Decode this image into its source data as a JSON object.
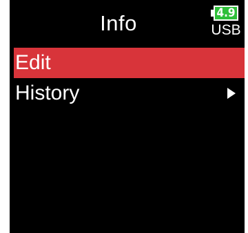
{
  "header": {
    "title": "Info"
  },
  "power": {
    "battery_voltage": "4.9",
    "source": "USB",
    "battery_color": "#2fbf3a"
  },
  "menu": {
    "items": [
      {
        "label": "Edit",
        "selected": true,
        "has_submenu": false
      },
      {
        "label": "History",
        "selected": false,
        "has_submenu": true
      }
    ],
    "selection_color": "#d8343a"
  }
}
